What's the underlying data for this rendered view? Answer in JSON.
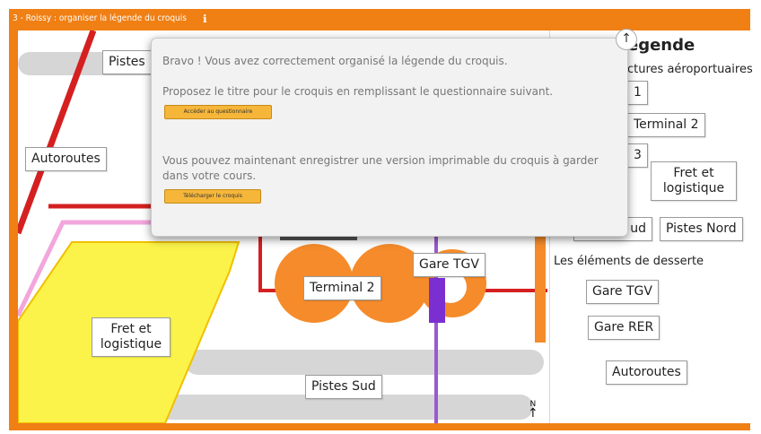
{
  "window": {
    "title": "3 - Roissy : organiser la légende du croquis"
  },
  "map": {
    "labels": {
      "pistes_nord": "Pistes",
      "autoroutes": "Autoroutes",
      "fret": "Fret et logistique",
      "terminal2": "Terminal 2",
      "gare_tgv": "Gare TGV",
      "pistes_sud": "Pistes Sud"
    },
    "north": "N"
  },
  "legend": {
    "heading": "égende",
    "subtitle_infra": "ctures aéroportuaires",
    "items": [
      "1",
      "Terminal 2",
      "3",
      "Fret et logistique",
      "ud",
      "Pistes Nord"
    ],
    "subtitle_desserte": "Les éléments de desserte",
    "desserte": [
      "Gare TGV",
      "Gare RER",
      "Autoroutes"
    ]
  },
  "popup": {
    "line1": "Bravo ! Vous avez correctement organisé la légende du croquis.",
    "line2": "Proposez le titre pour le croquis en remplissant le questionnaire suivant.",
    "button1": "Accéder au questionnaire",
    "line3": "Vous pouvez maintenant enregistrer une version imprimable du croquis à garder dans votre cours.",
    "button2": "Télécharger le croquis"
  },
  "colors": {
    "frame": "#f07f14",
    "terminal": "#f58b2a",
    "fret": "#fbf34a",
    "rail": "#9b59d0",
    "road": "#d42020",
    "pink": "#f2a6dc",
    "runway": "#d6d6d6"
  }
}
